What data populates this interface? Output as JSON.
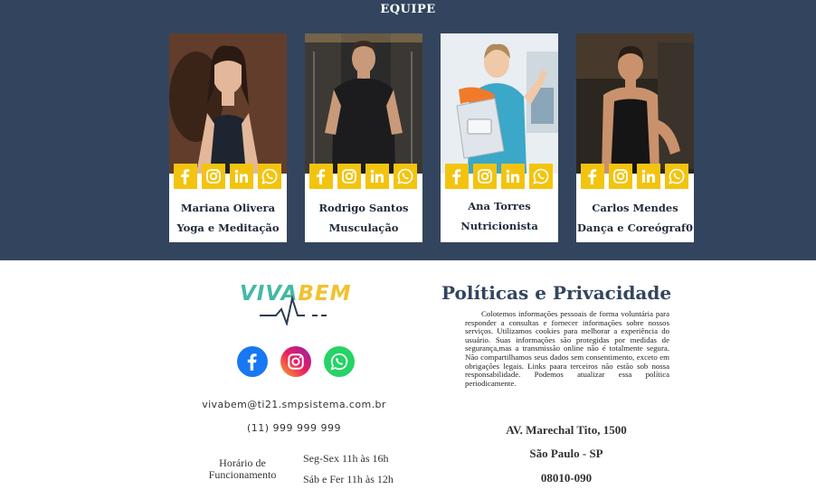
{
  "team": {
    "title": "EQUIPE",
    "members": [
      {
        "name": "Mariana Olivera",
        "role": "Yoga e Meditação"
      },
      {
        "name": "Rodrigo Santos",
        "role": "Musculação"
      },
      {
        "name": "Ana Torres",
        "role": "Nutricionista"
      },
      {
        "name": "Carlos Mendes",
        "role": "Dança e Coreógraf0"
      }
    ],
    "social_icons": [
      "facebook-icon",
      "instagram-icon",
      "linkedin-icon",
      "whatsapp-icon"
    ]
  },
  "footer": {
    "logo": {
      "part1": "VIVA",
      "part2": "BEM"
    },
    "brand_icons": [
      "facebook-icon",
      "instagram-icon",
      "whatsapp-icon"
    ],
    "email": "vivabem@ti21.smpsistema.com.br",
    "phone": "(11) 999 999 999",
    "hours": {
      "label": "Horário de Funcionamento",
      "weekdays": "Seg-Sex 11h às 16h",
      "weekend": "Sáb e Fer 11h às 12h"
    },
    "policy": {
      "title": "Políticas e Privacidade",
      "text": "Colotemos informações pessoais de forma voluntária para responder a consultas e fornecer informações sobre nossos serviços. Utilizamos cookies para melhorar a experiência do usuário. Suas informações são protegidas por medidas de segurança,mas a transmissão online não é totalmente segura. Não compartilhamos seus dados sem consentimento, exceto em obrigações legais. Links paara terceiros não estão sob nossa responsabilidade. Podemos atualizar essa política periodicamente."
    },
    "address": {
      "street": "AV. Marechal Tito, 1500",
      "city": "São Paulo - SP",
      "zip": "08010-090"
    }
  },
  "colors": {
    "navy": "#33455e",
    "social_yellow": "#f3c40f",
    "logo_teal": "#46b8a6",
    "logo_yellow": "#f2c12e"
  }
}
